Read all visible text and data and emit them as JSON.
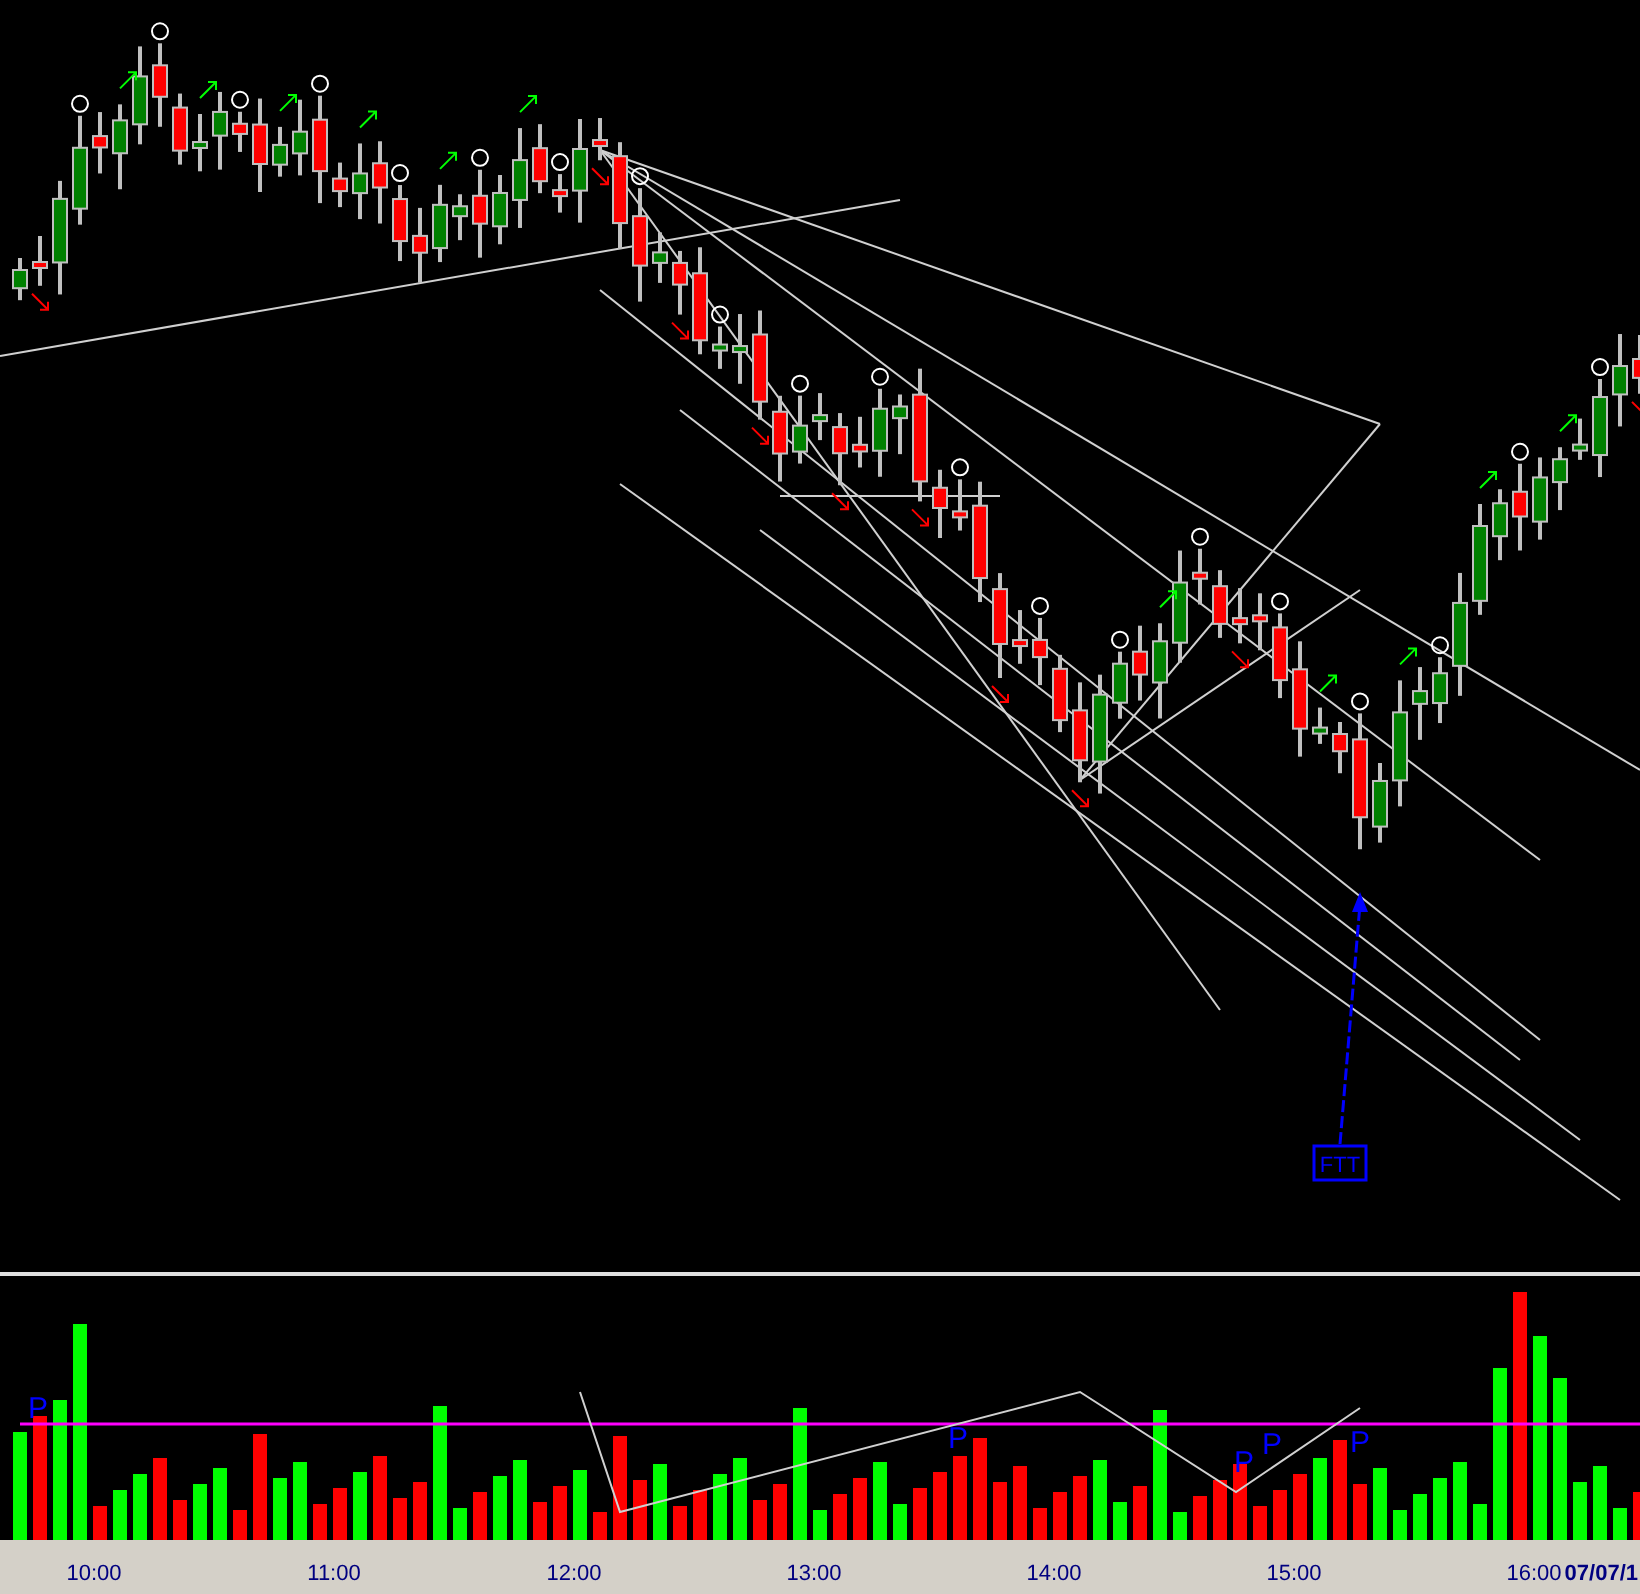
{
  "price_pane": {
    "annotation": {
      "label": "FTT"
    }
  },
  "volume_pane": {
    "markers": [
      {
        "label": "P"
      },
      {
        "label": "P"
      },
      {
        "label": "P"
      },
      {
        "label": "P"
      },
      {
        "label": "P"
      }
    ]
  },
  "time_axis": {
    "labels": [
      "10:00",
      "11:00",
      "12:00",
      "13:00",
      "14:00",
      "15:00",
      "16:00"
    ],
    "date": "07/07/1"
  }
}
